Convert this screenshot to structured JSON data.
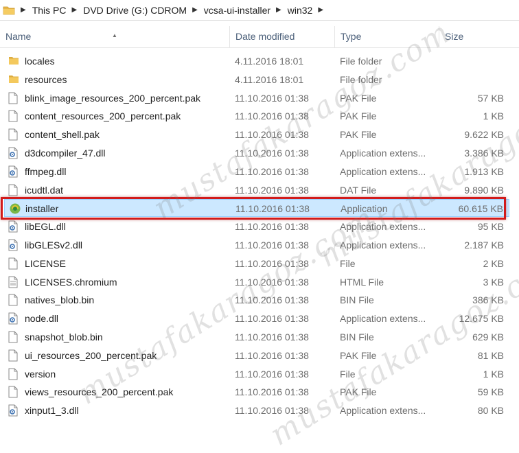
{
  "breadcrumb": {
    "items": [
      "This PC",
      "DVD Drive (G:) CDROM",
      "vcsa-ui-installer",
      "win32"
    ]
  },
  "columns": {
    "name": "Name",
    "date": "Date modified",
    "type": "Type",
    "size": "Size"
  },
  "files": [
    {
      "name": "locales",
      "date": "4.11.2016 18:01",
      "type": "File folder",
      "size": "",
      "icon": "folder-icon"
    },
    {
      "name": "resources",
      "date": "4.11.2016 18:01",
      "type": "File folder",
      "size": "",
      "icon": "folder-icon"
    },
    {
      "name": "blink_image_resources_200_percent.pak",
      "date": "11.10.2016 01:38",
      "type": "PAK File",
      "size": "57 KB",
      "icon": "file-icon"
    },
    {
      "name": "content_resources_200_percent.pak",
      "date": "11.10.2016 01:38",
      "type": "PAK File",
      "size": "1 KB",
      "icon": "file-icon"
    },
    {
      "name": "content_shell.pak",
      "date": "11.10.2016 01:38",
      "type": "PAK File",
      "size": "9.622 KB",
      "icon": "file-icon"
    },
    {
      "name": "d3dcompiler_47.dll",
      "date": "11.10.2016 01:38",
      "type": "Application extens...",
      "size": "3.386 KB",
      "icon": "dll-icon"
    },
    {
      "name": "ffmpeg.dll",
      "date": "11.10.2016 01:38",
      "type": "Application extens...",
      "size": "1.913 KB",
      "icon": "dll-icon"
    },
    {
      "name": "icudtl.dat",
      "date": "11.10.2016 01:38",
      "type": "DAT File",
      "size": "9.890 KB",
      "icon": "file-icon"
    },
    {
      "name": "installer",
      "date": "11.10.2016 01:38",
      "type": "Application",
      "size": "60.615 KB",
      "icon": "app-icon",
      "selected": true
    },
    {
      "name": "libEGL.dll",
      "date": "11.10.2016 01:38",
      "type": "Application extens...",
      "size": "95 KB",
      "icon": "dll-icon"
    },
    {
      "name": "libGLESv2.dll",
      "date": "11.10.2016 01:38",
      "type": "Application extens...",
      "size": "2.187 KB",
      "icon": "dll-icon"
    },
    {
      "name": "LICENSE",
      "date": "11.10.2016 01:38",
      "type": "File",
      "size": "2 KB",
      "icon": "file-icon"
    },
    {
      "name": "LICENSES.chromium",
      "date": "11.10.2016 01:38",
      "type": "HTML File",
      "size": "3 KB",
      "icon": "html-file-icon"
    },
    {
      "name": "natives_blob.bin",
      "date": "11.10.2016 01:38",
      "type": "BIN File",
      "size": "386 KB",
      "icon": "file-icon"
    },
    {
      "name": "node.dll",
      "date": "11.10.2016 01:38",
      "type": "Application extens...",
      "size": "12.675 KB",
      "icon": "dll-icon"
    },
    {
      "name": "snapshot_blob.bin",
      "date": "11.10.2016 01:38",
      "type": "BIN File",
      "size": "629 KB",
      "icon": "file-icon"
    },
    {
      "name": "ui_resources_200_percent.pak",
      "date": "11.10.2016 01:38",
      "type": "PAK File",
      "size": "81 KB",
      "icon": "file-icon"
    },
    {
      "name": "version",
      "date": "11.10.2016 01:38",
      "type": "File",
      "size": "1 KB",
      "icon": "file-icon"
    },
    {
      "name": "views_resources_200_percent.pak",
      "date": "11.10.2016 01:38",
      "type": "PAK File",
      "size": "59 KB",
      "icon": "file-icon"
    },
    {
      "name": "xinput1_3.dll",
      "date": "11.10.2016 01:38",
      "type": "Application extens...",
      "size": "80 KB",
      "icon": "dll-icon"
    }
  ],
  "colors": {
    "selection_bg": "#cce8ff",
    "selection_border": "#99d1ff",
    "highlight_box": "#d11b1b",
    "header_text": "#4c607a",
    "meta_text": "#6d6d6d"
  },
  "watermark": "mustafakaragoz.com"
}
